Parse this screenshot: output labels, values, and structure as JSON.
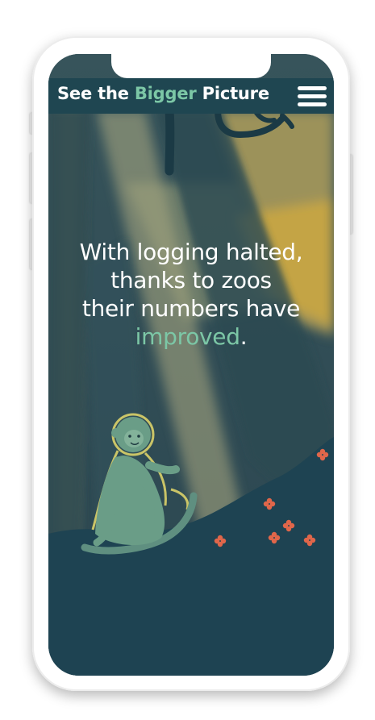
{
  "header": {
    "brand_part1": "See the ",
    "brand_accent": "Bigger",
    "brand_part2": " Picture"
  },
  "icons": {
    "menu": "hamburger-menu-icon"
  },
  "hero": {
    "line1": "With logging halted,",
    "line2": "thanks to zoos",
    "line3": "their numbers have",
    "line4_accent": "improved",
    "line4_end": "."
  },
  "colors": {
    "header_bg": "#1f4651",
    "accent_green": "#7cc7a6",
    "ground": "#1e4352",
    "sunbeam": "#cfa64a",
    "flower": "#e0664a",
    "monkey": "#6a9d87"
  }
}
